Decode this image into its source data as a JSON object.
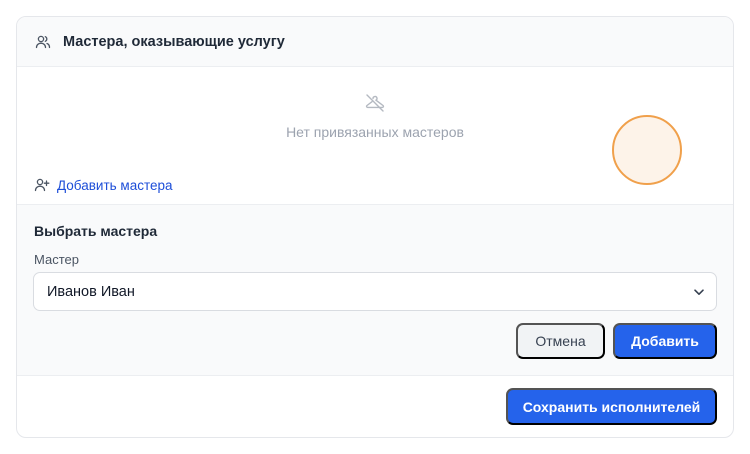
{
  "card": {
    "title": "Мастера, оказывающие услугу",
    "header_icon": "users-icon"
  },
  "empty_state": {
    "icon": "hanger-off-icon",
    "text": "Нет привязанных мастеров"
  },
  "add_link": {
    "icon": "user-plus-icon",
    "label": "Добавить мастера"
  },
  "select_section": {
    "title": "Выбрать мастера",
    "field_label": "Мастер",
    "selected_value": "Иванов Иван",
    "chevron_icon": "chevron-down-icon",
    "cancel_label": "Отмена",
    "add_label": "Добавить"
  },
  "footer": {
    "save_label": "Сохранить исполнителей"
  },
  "colors": {
    "primary": "#2563eb",
    "link": "#1d4ed8",
    "muted_text": "#9ca3af",
    "panel_bg": "#f9fafb",
    "click_marker": "#f0a04b"
  }
}
